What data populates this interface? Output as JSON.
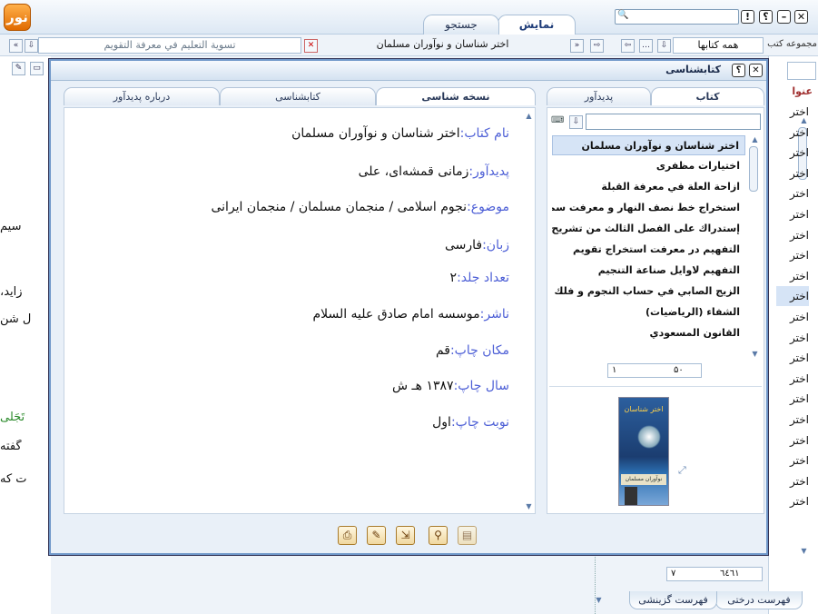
{
  "app": {
    "logo": "نور"
  },
  "toolbar": {
    "help_label": "؟",
    "info_label": "!",
    "tabs": [
      {
        "label": "نمایش"
      },
      {
        "label": "جستجو"
      }
    ]
  },
  "navbar": {
    "current_title": "اختر شناسان و نوآوران مسلمان",
    "other_title": "تسوية التعليم في معرفة التقويم",
    "library_select": "همه کتابها",
    "library_label": "مجموعه کتب"
  },
  "background": {
    "lines": [
      "سیم",
      "زاید،",
      "ل شن",
      "تَجَلّی",
      "گفته",
      "ت که"
    ]
  },
  "right_panel": {
    "header": "عنوا",
    "item": "اختر",
    "bottom_tabs": [
      {
        "label": "فهرست درختی"
      },
      {
        "label": "فهرست گزینشی"
      }
    ],
    "pager": {
      "current": "۷",
      "total": "٦٤٦١"
    }
  },
  "dialog": {
    "title": "کتابشناسی",
    "tabs_left": [
      {
        "label": "درباره پدیدآور"
      },
      {
        "label": "کتابشناسی"
      },
      {
        "label": "نسخه شناسی"
      }
    ],
    "tabs_right": [
      {
        "label": "پدیدآور"
      },
      {
        "label": "کتاب"
      }
    ],
    "fields": [
      {
        "label": "نام کتاب:",
        "value": "اختر شناسان و نوآوران مسلمان"
      },
      {
        "label": "پدیدآور:",
        "value": "زمانی قمشه‌ای، علی"
      },
      {
        "label": "موضوع:",
        "value": "نجوم اسلامی / منجمان مسلمان / منجمان ایرانی"
      },
      {
        "label": "زبان:",
        "value": "فارسی"
      },
      {
        "label": "تعداد جلد:",
        "value": "۲"
      },
      {
        "label": "ناشر:",
        "value": "موسسه امام صادق علیه السلام"
      },
      {
        "label": "مکان چاپ:",
        "value": "قم"
      },
      {
        "label": "سال چاپ:",
        "value": "۱۳۸۷ هـ ش"
      },
      {
        "label": "نوبت چاپ:",
        "value": "اول"
      }
    ],
    "books": [
      "اختر شناسان و نوآوران مسلمان",
      "اختیارات مظفری",
      "ازاحة العلة في معرفة القبلة",
      "استخراج خط نصف النهار و معرفت سمت ...",
      "إستدراك على الفصل الثالث من تشريح ا...",
      "التفهیم در معرفت استخراج تقویم",
      "التفهيم لاوايل صناعة التنجيم",
      "الزيج الصابي في حساب النجوم و فلك الب...",
      "الشفاء (الرياضيات)",
      "القانون المسعودي"
    ],
    "pager": {
      "page": "۱",
      "per_page": "۵۰"
    },
    "cover": {
      "title": "اختر شناسان",
      "caption": "نوآوران مسلمان"
    },
    "footer_buttons": [
      "print",
      "edit",
      "export",
      "search",
      "copy"
    ]
  }
}
